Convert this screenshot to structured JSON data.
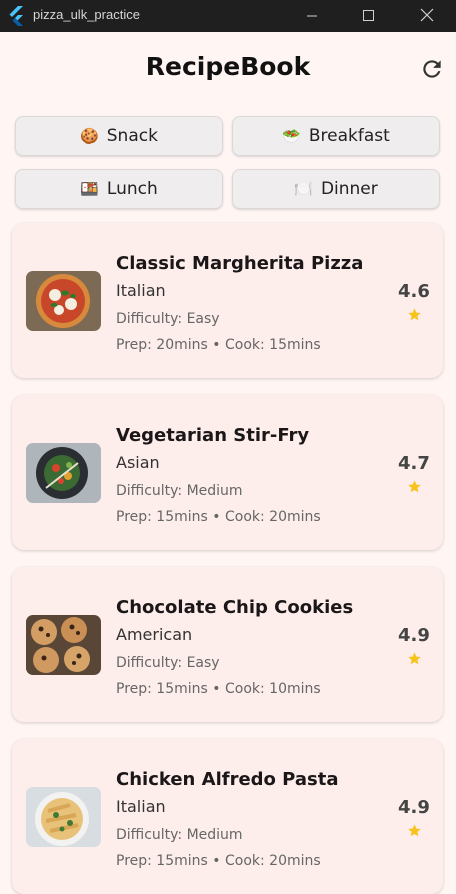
{
  "window": {
    "title": "pizza_ulk_practice"
  },
  "app": {
    "title": "RecipeBook"
  },
  "categories": [
    {
      "label": "Snack",
      "emoji": "🍪"
    },
    {
      "label": "Breakfast",
      "emoji": "🥗"
    },
    {
      "label": "Lunch",
      "emoji": "🍱"
    },
    {
      "label": "Dinner",
      "emoji": "🍽️"
    }
  ],
  "recipes": [
    {
      "name": "Classic Margherita Pizza",
      "cuisine": "Italian",
      "difficulty": "Difficulty: Easy",
      "time": "Prep: 20mins • Cook: 15mins",
      "rating": "4.6"
    },
    {
      "name": "Vegetarian Stir-Fry",
      "cuisine": "Asian",
      "difficulty": "Difficulty: Medium",
      "time": "Prep: 15mins • Cook: 20mins",
      "rating": "4.7"
    },
    {
      "name": "Chocolate Chip Cookies",
      "cuisine": "American",
      "difficulty": "Difficulty: Easy",
      "time": "Prep: 15mins • Cook: 10mins",
      "rating": "4.9"
    },
    {
      "name": "Chicken Alfredo Pasta",
      "cuisine": "Italian",
      "difficulty": "Difficulty: Medium",
      "time": "Prep: 15mins • Cook: 20mins",
      "rating": "4.9"
    }
  ],
  "colors": {
    "star": "#f7c21a",
    "card": "#fdeeec",
    "background": "#fff6f4"
  }
}
